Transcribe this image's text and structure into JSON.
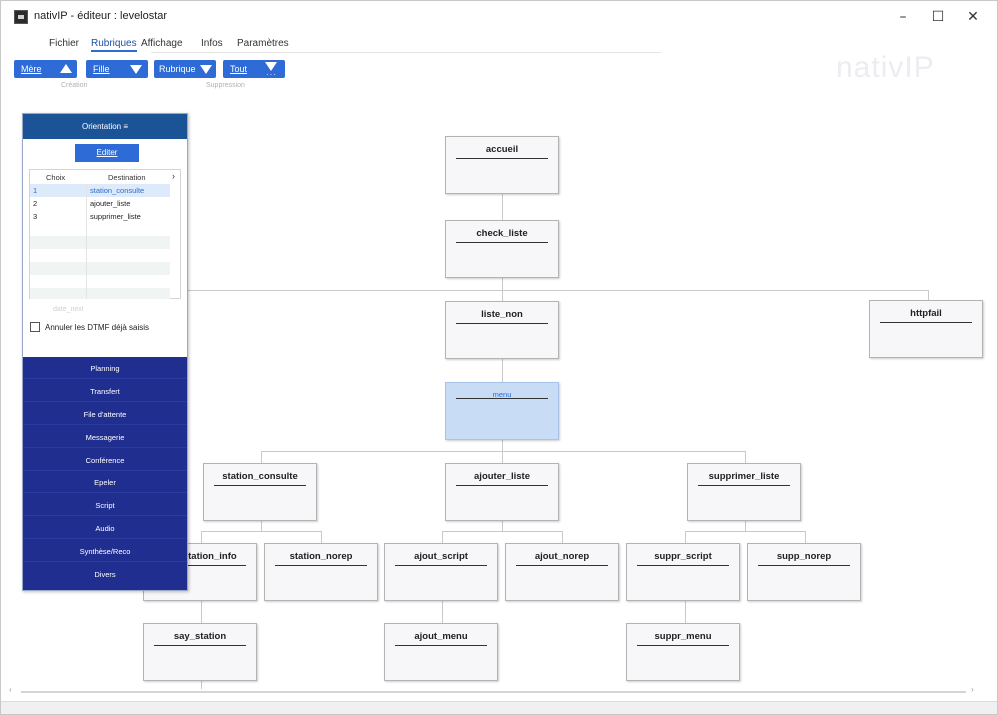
{
  "window": {
    "title": "nativIP - éditeur : levelostar",
    "minimize_glyph": "–",
    "maximize_glyph": "☐",
    "close_glyph": "✕"
  },
  "menu": [
    "Fichier",
    "Rubriques",
    "Affichage",
    "Infos",
    "Paramètres"
  ],
  "menu_active": "Rubriques",
  "ribbon": {
    "buttons": [
      {
        "label": "Mère",
        "icon": "triangle-up-icon"
      },
      {
        "label": "Fille",
        "icon": "triangle-down-icon"
      },
      {
        "label": "Rubrique",
        "icon": "triangle-down-icon"
      },
      {
        "label": "Tout",
        "icon": "triangle-down-dots-icon"
      }
    ],
    "groups": [
      "Création",
      "Suppression"
    ]
  },
  "logo": "nativIP",
  "flow_nodes": [
    "accueil",
    "check_liste",
    "liste_non",
    "httpfail",
    "menu",
    "station_consulte",
    "ajouter_liste",
    "supprimer_liste",
    "get_station_info",
    "station_norep",
    "ajout_script",
    "ajout_norep",
    "suppr_script",
    "supp_norep",
    "say_station",
    "ajout_menu",
    "suppr_menu"
  ],
  "panel": {
    "title": "Orientation ≡",
    "edit_button": "Editer",
    "columns": [
      "Choix",
      "Destination"
    ],
    "rows": [
      {
        "choice": "1",
        "dest": "station_consulte"
      },
      {
        "choice": "2",
        "dest": "ajouter_liste"
      },
      {
        "choice": "3",
        "dest": "supprimer_liste"
      }
    ],
    "faded_text": "date_next",
    "checkbox_label": "Annuler les DTMF déjà saisis",
    "actions": [
      "Planning",
      "Transfert",
      "File d'attente",
      "Messagerie",
      "Conférence",
      "Epeler",
      "Script",
      "Audio",
      "Synthèse/Reco",
      "Divers"
    ]
  },
  "colors": {
    "accent": "#2e6bd6",
    "panel_header": "#1b5397",
    "actions_bg": "#1f2e8f",
    "menu_node": "#c9dcf6"
  }
}
